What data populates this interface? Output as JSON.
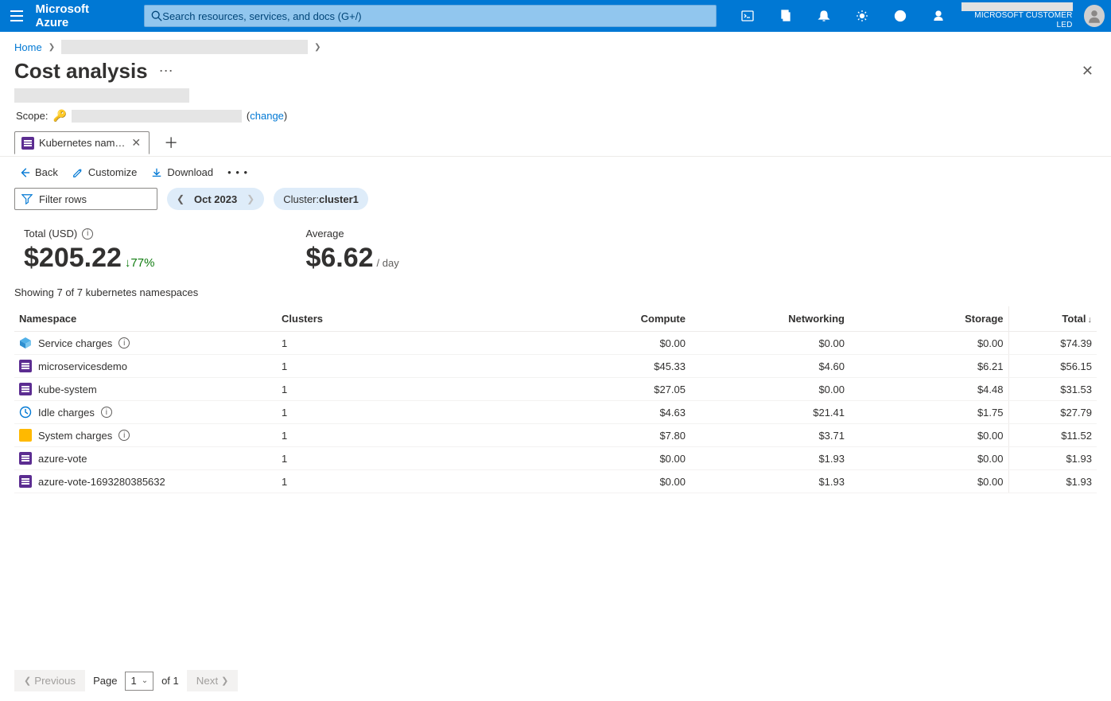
{
  "header": {
    "brand": "Microsoft Azure",
    "search_placeholder": "Search resources, services, and docs (G+/)",
    "tenant": "MICROSOFT CUSTOMER LED"
  },
  "breadcrumb": {
    "home": "Home"
  },
  "page": {
    "title": "Cost analysis"
  },
  "scope": {
    "label": "Scope:",
    "change": "change"
  },
  "tab": {
    "label": "Kubernetes nam…"
  },
  "commands": {
    "back": "Back",
    "customize": "Customize",
    "download": "Download"
  },
  "filters": {
    "filter_rows": "Filter rows",
    "month": "Oct 2023",
    "cluster_label": "Cluster: ",
    "cluster_value": "cluster1"
  },
  "summary": {
    "total_label": "Total (USD)",
    "total_value": "$205.22",
    "trend": "77%",
    "avg_label": "Average",
    "avg_value": "$6.62",
    "avg_unit": "/ day"
  },
  "showing": "Showing 7 of 7 kubernetes namespaces",
  "columns": {
    "namespace": "Namespace",
    "clusters": "Clusters",
    "compute": "Compute",
    "networking": "Networking",
    "storage": "Storage",
    "total": "Total"
  },
  "rows": [
    {
      "icon": "svc",
      "name": "Service charges",
      "info": true,
      "clusters": "1",
      "compute": "$0.00",
      "networking": "$0.00",
      "storage": "$0.00",
      "total": "$74.39"
    },
    {
      "icon": "ns",
      "name": "microservicesdemo",
      "info": false,
      "clusters": "1",
      "compute": "$45.33",
      "networking": "$4.60",
      "storage": "$6.21",
      "total": "$56.15"
    },
    {
      "icon": "ns",
      "name": "kube-system",
      "info": false,
      "clusters": "1",
      "compute": "$27.05",
      "networking": "$0.00",
      "storage": "$4.48",
      "total": "$31.53"
    },
    {
      "icon": "idle",
      "name": "Idle charges",
      "info": true,
      "clusters": "1",
      "compute": "$4.63",
      "networking": "$21.41",
      "storage": "$1.75",
      "total": "$27.79"
    },
    {
      "icon": "sys",
      "name": "System charges",
      "info": true,
      "clusters": "1",
      "compute": "$7.80",
      "networking": "$3.71",
      "storage": "$0.00",
      "total": "$11.52"
    },
    {
      "icon": "ns",
      "name": "azure-vote",
      "info": false,
      "clusters": "1",
      "compute": "$0.00",
      "networking": "$1.93",
      "storage": "$0.00",
      "total": "$1.93"
    },
    {
      "icon": "ns",
      "name": "azure-vote-1693280385632",
      "info": false,
      "clusters": "1",
      "compute": "$0.00",
      "networking": "$1.93",
      "storage": "$0.00",
      "total": "$1.93"
    }
  ],
  "pager": {
    "previous": "Previous",
    "next": "Next",
    "page_label": "Page",
    "page_num": "1",
    "of": "of 1"
  }
}
